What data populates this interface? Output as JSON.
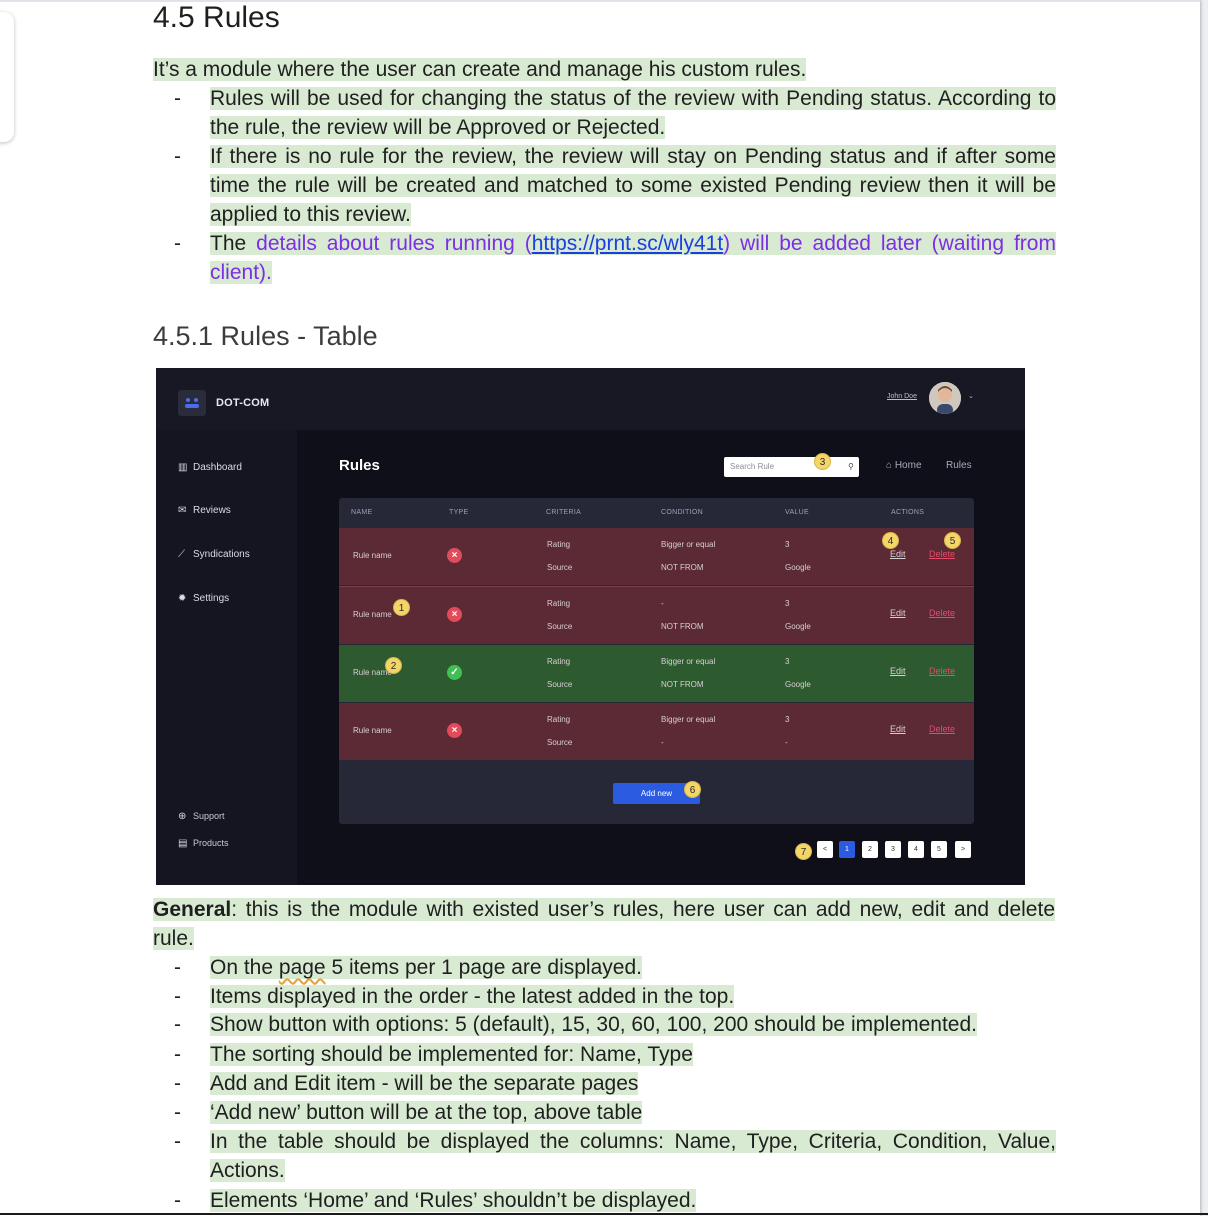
{
  "heading": "4.5 Rules",
  "intro": "It’s a module where the user can create and manage his custom rules.",
  "bullets": [
    "-",
    "Rules will be used for changing the status of the review with Pending status. According to the rule, the review will be Approved or Rejected.",
    "If there is no rule for the review, the review will stay on Pending status and if after some time the rule will be created and matched to some existed Pending review then it will be applied to this review."
  ],
  "bullet3": {
    "prefix": "The ",
    "purple_a": "details about rules running (",
    "link": "https://prnt.sc/wly41t",
    "purple_b": ")  will be added later (waiting from client)."
  },
  "subheading": "4.5.1 Rules - Table",
  "screenshot": {
    "brand": "DOT-COM",
    "user": "John Doe",
    "nav": [
      "Dashboard",
      "Reviews",
      "Syndications",
      "Settings"
    ],
    "nav_bottom": [
      "Support",
      "Products"
    ],
    "title": "Rules",
    "search_placeholder": "Search Rule",
    "breadcrumb": [
      "Home",
      "Rules"
    ],
    "columns": [
      "NAME",
      "TYPE",
      "CRITERIA",
      "CONDITION",
      "VALUE",
      "ACTIONS"
    ],
    "rows": [
      {
        "name": "Rule name",
        "status": "rejected",
        "crit1": "Rating",
        "crit2": "Source",
        "cond1": "Bigger or equal",
        "cond2": "NOT FROM",
        "val1": "3",
        "val2": "Google",
        "edit": "Edit",
        "delete": "Delete"
      },
      {
        "name": "Rule name",
        "status": "rejected",
        "crit1": "Rating",
        "crit2": "Source",
        "cond1": "-",
        "cond2": "NOT FROM",
        "val1": "3",
        "val2": "Google",
        "edit": "Edit",
        "delete": "Delete"
      },
      {
        "name": "Rule name",
        "status": "approved",
        "crit1": "Rating",
        "crit2": "Source",
        "cond1": "Bigger or equal",
        "cond2": "NOT FROM",
        "val1": "3",
        "val2": "Google",
        "edit": "Edit",
        "delete": "Delete"
      },
      {
        "name": "Rule name",
        "status": "rejected",
        "crit1": "Rating",
        "crit2": "Source",
        "cond1": "Bigger or equal",
        "cond2": "-",
        "val1": "3",
        "val2": "-",
        "edit": "Edit",
        "delete": "Delete"
      }
    ],
    "add_button": "Add new",
    "pager": [
      "<",
      "1",
      "2",
      "3",
      "4",
      "5",
      ">"
    ],
    "badges": [
      "1",
      "2",
      "3",
      "4",
      "5",
      "6",
      "7"
    ],
    "colors": {
      "rejected_row": "#5b2a34",
      "approved_row": "#2d5a2f",
      "accent": "#2b5be0",
      "badge": "#f3d568"
    }
  },
  "general": {
    "label": "General",
    "text": ": this is the module with existed user’s rules, here user can add new, edit and delete rule."
  },
  "list2": [
    {
      "pre": "On the ",
      "squiggle": "page",
      "post": " 5 items per 1 page are displayed."
    },
    {
      "pre": "Items displayed in the order - the latest added in the top.",
      "squiggle": "",
      "post": ""
    },
    {
      "pre": "Show button with options: 5 (default), 15, 30, 60, 100, 200 should be implemented.",
      "squiggle": "",
      "post": ""
    },
    {
      "pre": "The sorting should be implemented for: Name, Type",
      "squiggle": "",
      "post": ""
    },
    {
      "pre": "Add and Edit item - will be the separate pages",
      "squiggle": "",
      "post": ""
    },
    {
      "pre": "‘Add new’  button will be at the top, above table",
      "squiggle": "",
      "post": ""
    },
    {
      "pre": "In the table should be displayed the columns:  Name, Type, Criteria,  Condition, Value, Actions.",
      "squiggle": "",
      "post": ""
    },
    {
      "pre": "Elements ‘Home’ and ‘Rules’ shouldn’t be displayed.",
      "squiggle": "",
      "post": ""
    }
  ]
}
